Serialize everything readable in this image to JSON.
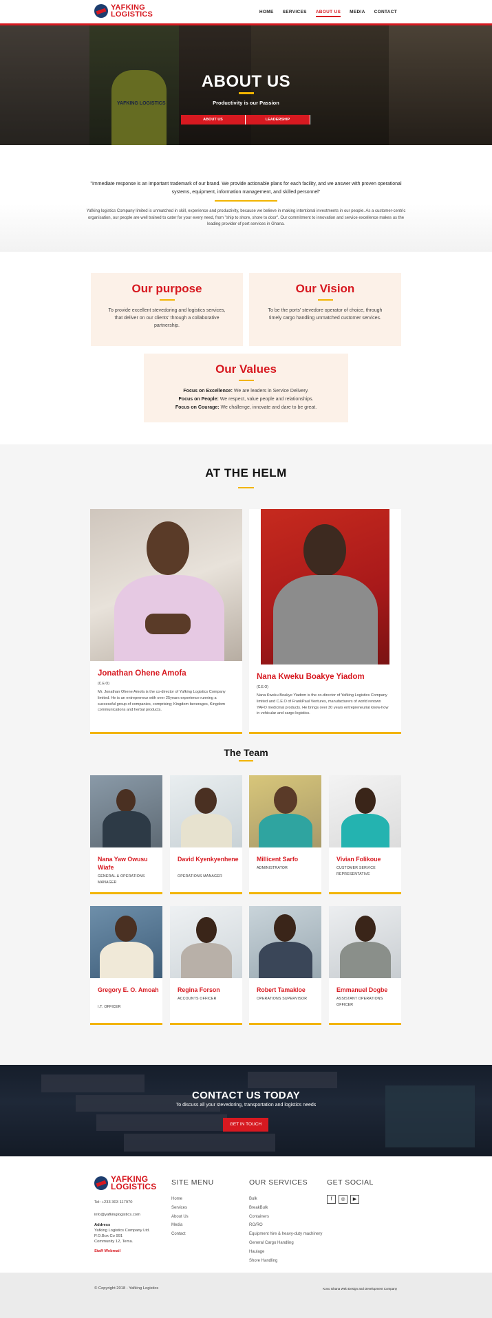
{
  "header": {
    "logo_line1": "YAFKING",
    "logo_line2": "LOGISTICS",
    "nav": [
      {
        "label": "HOME"
      },
      {
        "label": "SERVICES"
      },
      {
        "label": "ABOUT US"
      },
      {
        "label": "MEDIA"
      },
      {
        "label": "CONTACT"
      }
    ],
    "active_nav": "ABOUT US"
  },
  "hero": {
    "title": "ABOUT US",
    "subtitle": "Productivity is our Passion",
    "vest_text": "YAFKING LOGISTICS",
    "tabs": [
      {
        "label": "ABOUT US"
      },
      {
        "label": "LEADERSHIP"
      }
    ]
  },
  "intro": {
    "quote": "\"Immediate response is an important trademark of our brand. We provide actionable plans for each facility, and we answer with proven operational systems, equipment, information management, and skilled personnel\"",
    "body": "Yafking logistics Company limited is unmatched in skill, experience and productivity, because we believe in making intentional investments in our people. As a customer-centric organisation, our people are well trained to cater for your every need, from \"ship to shore, shore to door\". Our commitment to innovation and service excellence makes us the leading provider of port services in Ghana."
  },
  "purpose": {
    "title": "Our purpose",
    "text": "To provide excellent stevedoring and logistics services, that deliver on our clients' through a collaborative partnership."
  },
  "vision": {
    "title": "Our Vision",
    "text": "To be the ports' stevedore operator of choice, through timely cargo handling unmatched customer services."
  },
  "values": {
    "title": "Our Values",
    "items": [
      {
        "label": "Focus on Excellence:",
        "text": " We are leaders in Service Delivery."
      },
      {
        "label": "Focus on People:",
        "text": " We respect, value people and relationships."
      },
      {
        "label": "Focus on Courage:",
        "text": " We challenge, innovate and dare to be great."
      }
    ]
  },
  "helm": {
    "title": "AT THE HELM",
    "leaders": [
      {
        "name": "Jonathan Ohene Amofa",
        "role": "(C.E.O)",
        "bio": "Mr. Jonathan Ohene Amofa is the co-director of Yafking Logistics Company limited. He is an entrepreneur with over 25years experience running a successful group of companies, comprising; Kingdom beverages, Kingdom communications and herbal products."
      },
      {
        "name": "Nana Kweku Boakye Yiadom",
        "role": "(C.E.O)",
        "bio": "Nana Kweku Boakye Yiadom is the co-director of Yafking Logistics Company limited and C.E.O of FrankPaul Ventures, manufacturers of world renown YAFO medicinal products. He brings over 30 years entrepreneurial know-how in vehicular and cargo logistics."
      }
    ]
  },
  "team": {
    "title": "The Team",
    "members": [
      {
        "name": "Nana Yaw Owusu Wiafe",
        "role": "General & Operations Manager"
      },
      {
        "name": "David Kyenkyenhene",
        "role": "Operations Manager"
      },
      {
        "name": "Millicent Sarfo",
        "role": "Administrator"
      },
      {
        "name": "Vivian Folikoue",
        "role": "Customer Service Representative"
      },
      {
        "name": "Gregory E. O. Amoah",
        "role": "I.T. Officer"
      },
      {
        "name": "Regina Forson",
        "role": "Accounts Officer"
      },
      {
        "name": "Robert Tamakloe",
        "role": "Operations Supervisor"
      },
      {
        "name": "Emmanuel Dogbe",
        "role": "Assistant Operations Officer"
      }
    ]
  },
  "cta": {
    "title": "CONTACT US TODAY",
    "subtitle": "To discuss all your stevedoring, transportation and logistics needs",
    "button": "GET IN TOUCH"
  },
  "footer": {
    "logo_line1": "YAFKING",
    "logo_line2": "LOGISTICS",
    "tel": "Tel: +233 303 117970",
    "email": "info@yafkinglogistics.com",
    "address_label": "Address",
    "address1": "Yafking Logistics Company Ltd.",
    "address2": "P.O.Box Co 991",
    "address3": "Community 12, Tema.",
    "webmail": "Staff Webmail",
    "site_menu_title": "SITE MENU",
    "site_menu": [
      "Home",
      "Services",
      "About Us",
      "Media",
      "Contact"
    ],
    "services_title": "OUR SERVICES",
    "services": [
      "Bulk",
      "BreakBulk",
      "Containers",
      "RO/RO",
      "Equipment hire & heavy-duty machinery",
      "General Cargo Handling",
      "Haulage",
      "Shore Handling"
    ],
    "social_title": "GET SOCIAL",
    "social": [
      {
        "icon": "facebook-icon",
        "glyph": "f"
      },
      {
        "icon": "instagram-icon",
        "glyph": "◎"
      },
      {
        "icon": "youtube-icon",
        "glyph": "▶"
      }
    ],
    "copyright": "© Copyright 2018 - Yafking Logistics",
    "credit": "Kovo Ghana Web Design and Development Company"
  },
  "colors": {
    "brand_red": "#d71920",
    "accent_yellow": "#f2b400",
    "peach": "#fcf1e8"
  }
}
